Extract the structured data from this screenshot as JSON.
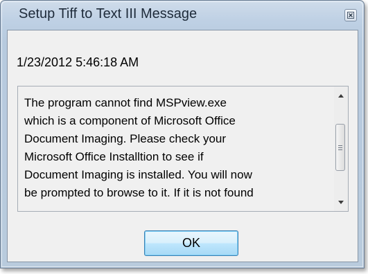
{
  "window": {
    "title": "Setup Tiff to Text III Message",
    "close_symbol": "⊠"
  },
  "timestamp": "1/23/2012 5:46:18 AM",
  "message": "The program cannot find MSPview.exe\nwhich is a component of Microsoft Office\nDocument Imaging. Please check your\nMicrosoft Office Installtion to see if\nDocument Imaging is installed. You will now\nbe prompted to browse to it. If it is not found",
  "buttons": {
    "ok_label": "OK"
  },
  "icons": {
    "close": "close-icon",
    "scroll_up": "chevron-up-icon",
    "scroll_down": "chevron-down-icon",
    "thumb_grip": "grip-icon"
  },
  "colors": {
    "titlebar": "#bed0e4",
    "client_background": "#f0f0f0",
    "ok_button_border": "#3c7fb1",
    "ok_button_fill": "#bee6fd"
  }
}
